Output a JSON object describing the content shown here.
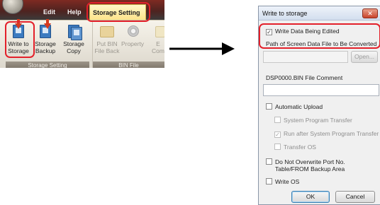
{
  "ribbon": {
    "tabs": [
      {
        "label": "Edit"
      },
      {
        "label": "Help"
      },
      {
        "label": "Storage Setting",
        "active": true
      }
    ],
    "groups": [
      {
        "caption": "Storage Setting",
        "buttons": [
          {
            "label1": "Write to",
            "label2": "Storage",
            "icon": "write-to-storage-icon"
          },
          {
            "label1": "Storage",
            "label2": "Backup",
            "icon": "storage-backup-icon"
          },
          {
            "label1": "Storage",
            "label2": "Copy",
            "icon": "storage-copy-icon"
          }
        ]
      },
      {
        "caption": "BIN File",
        "buttons": [
          {
            "label1": "Put BIN",
            "label2": "File Back",
            "icon": "folder-icon"
          },
          {
            "label1": "Property",
            "label2": "",
            "icon": "gear-icon"
          },
          {
            "label1": "E",
            "label2": "Com",
            "icon": "document-icon"
          }
        ]
      }
    ]
  },
  "dialog": {
    "title": "Write to storage",
    "close_label": "✕",
    "write_data_being_edited": {
      "label": "Write Data Being Edited",
      "checked": true
    },
    "path_label": "Path of Screen Data File to Be Converted",
    "path_value": "",
    "open_button": "Open...",
    "comment_label": "DSP0000.BIN File Comment",
    "comment_value": "",
    "automatic_upload": {
      "label": "Automatic Upload",
      "checked": false
    },
    "system_program_transfer": {
      "label": "System Program Transfer",
      "checked": false
    },
    "run_after_transfer": {
      "label": "Run after System Program Transfer",
      "checked": true
    },
    "transfer_os": {
      "label": "Transfer OS",
      "checked": false
    },
    "do_not_overwrite": {
      "label1": "Do Not Overwrite Port No.",
      "label2": "Table/FROM Backup Area",
      "checked": false
    },
    "write_os": {
      "label": "Write OS",
      "checked": false
    },
    "ok_button": "OK",
    "cancel_button": "Cancel"
  },
  "colors": {
    "highlight": "#e3202a",
    "active_tab": "#fde38a",
    "ribbon_dark": "#4f2320"
  }
}
